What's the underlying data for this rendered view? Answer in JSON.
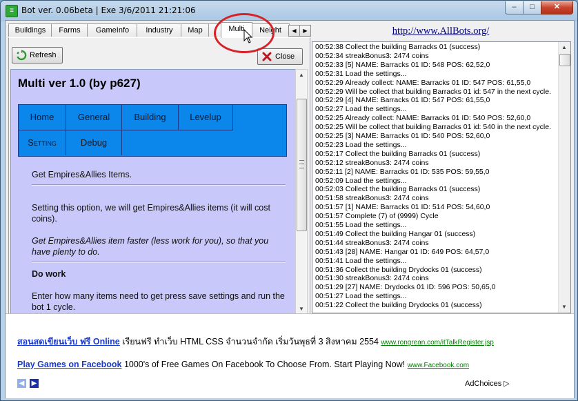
{
  "window": {
    "title": "Bot ver. 0.06beta | Exe 3/6/2011 21:21:06",
    "minimize": "–",
    "maximize": "□",
    "close": "✕"
  },
  "tabs": [
    "Buildings",
    "Farms",
    "GameInfo",
    "Industry",
    "Map",
    "Multi",
    "Neight"
  ],
  "active_tab": "Multi",
  "toolbar": {
    "refresh_label": "Refresh",
    "close_label": "Close"
  },
  "page": {
    "title": "Multi ver 1.0 (by p627)",
    "menu": [
      "Home",
      "General",
      "Building",
      "Levelup",
      "Setting",
      "Debug"
    ],
    "section1": "Get Empires&Allies Items.",
    "para1": "Setting this option, we will get Empires&Allies items (it will cost coins).",
    "para2": "Get Empires&Allies item faster (less work for you), so that you have plenty to do.",
    "section2": "Do work",
    "para3": "Enter how many items need to get press save settings and run the bot 1 cycle."
  },
  "site_link": "http://www.AllBots.org/",
  "log": [
    "00:52:38 Collect the building Barracks 01 (success)",
    "00:52:34 streakBonus3: 2474 coins",
    "00:52:33 [5] NAME: Barracks 01 ID: 548 POS: 62,52,0",
    "00:52:31 Load the settings...",
    "00:52:29 Already collect: NAME: Barracks 01 ID: 547 POS: 61,55,0",
    "00:52:29 Will be collect that building Barracks 01 id: 547 in the next cycle.",
    "00:52:29 [4] NAME: Barracks 01 ID: 547 POS: 61,55,0",
    "00:52:27 Load the settings...",
    "00:52:25 Already collect: NAME: Barracks 01 ID: 540 POS: 52,60,0",
    "00:52:25 Will be collect that building Barracks 01 id: 540 in the next cycle.",
    "00:52:25 [3] NAME: Barracks 01 ID: 540 POS: 52,60,0",
    "00:52:23 Load the settings...",
    "00:52:17 Collect the building Barracks 01 (success)",
    "00:52:12 streakBonus3: 2474 coins",
    "00:52:11 [2] NAME: Barracks 01 ID: 535 POS: 59,55,0",
    "00:52:09 Load the settings...",
    "00:52:03 Collect the building Barracks 01 (success)",
    "00:51:58 streakBonus3: 2474 coins",
    "00:51:57 [1] NAME: Barracks 01 ID: 514 POS: 54,60,0",
    "00:51:57 Complete (7) of (9999) Cycle",
    "00:51:55 Load the settings...",
    "00:51:49 Collect the building Hangar 01 (success)",
    "00:51:44 streakBonus3: 2474 coins",
    "00:51:43 [28] NAME: Hangar 01 ID: 649 POS: 64,57,0",
    "00:51:41 Load the settings...",
    "00:51:36 Collect the building Drydocks 01 (success)",
    "00:51:30 streakBonus3: 2474 coins",
    "00:51:29 [27] NAME: Drydocks 01 ID: 596 POS: 50,65,0",
    "00:51:27 Load the settings...",
    "00:51:22 Collect the building Drydocks 01 (success)"
  ],
  "ads": [
    {
      "link": "สอนสดเขียนเว็บ ฟรี Online",
      "text": "เรียนฟรี ทำเว็บ HTML CSS จำนวนจำกัด เริ่มวันพุธที่ 3 สิงหาคม 2554",
      "url": "www.rongrean.com/itTalkRegister.jsp"
    },
    {
      "link": "Play Games on Facebook",
      "text": "1000's of Free Games On Facebook To Choose From. Start Playing Now!",
      "url": "www.Facebook.com"
    }
  ],
  "adchoices": "AdChoices",
  "colors": {
    "content_bg": "#c8c8fa",
    "menu_bg": "#0b86ea",
    "highlight_circle": "#d8222a",
    "link_color": "#000080"
  }
}
